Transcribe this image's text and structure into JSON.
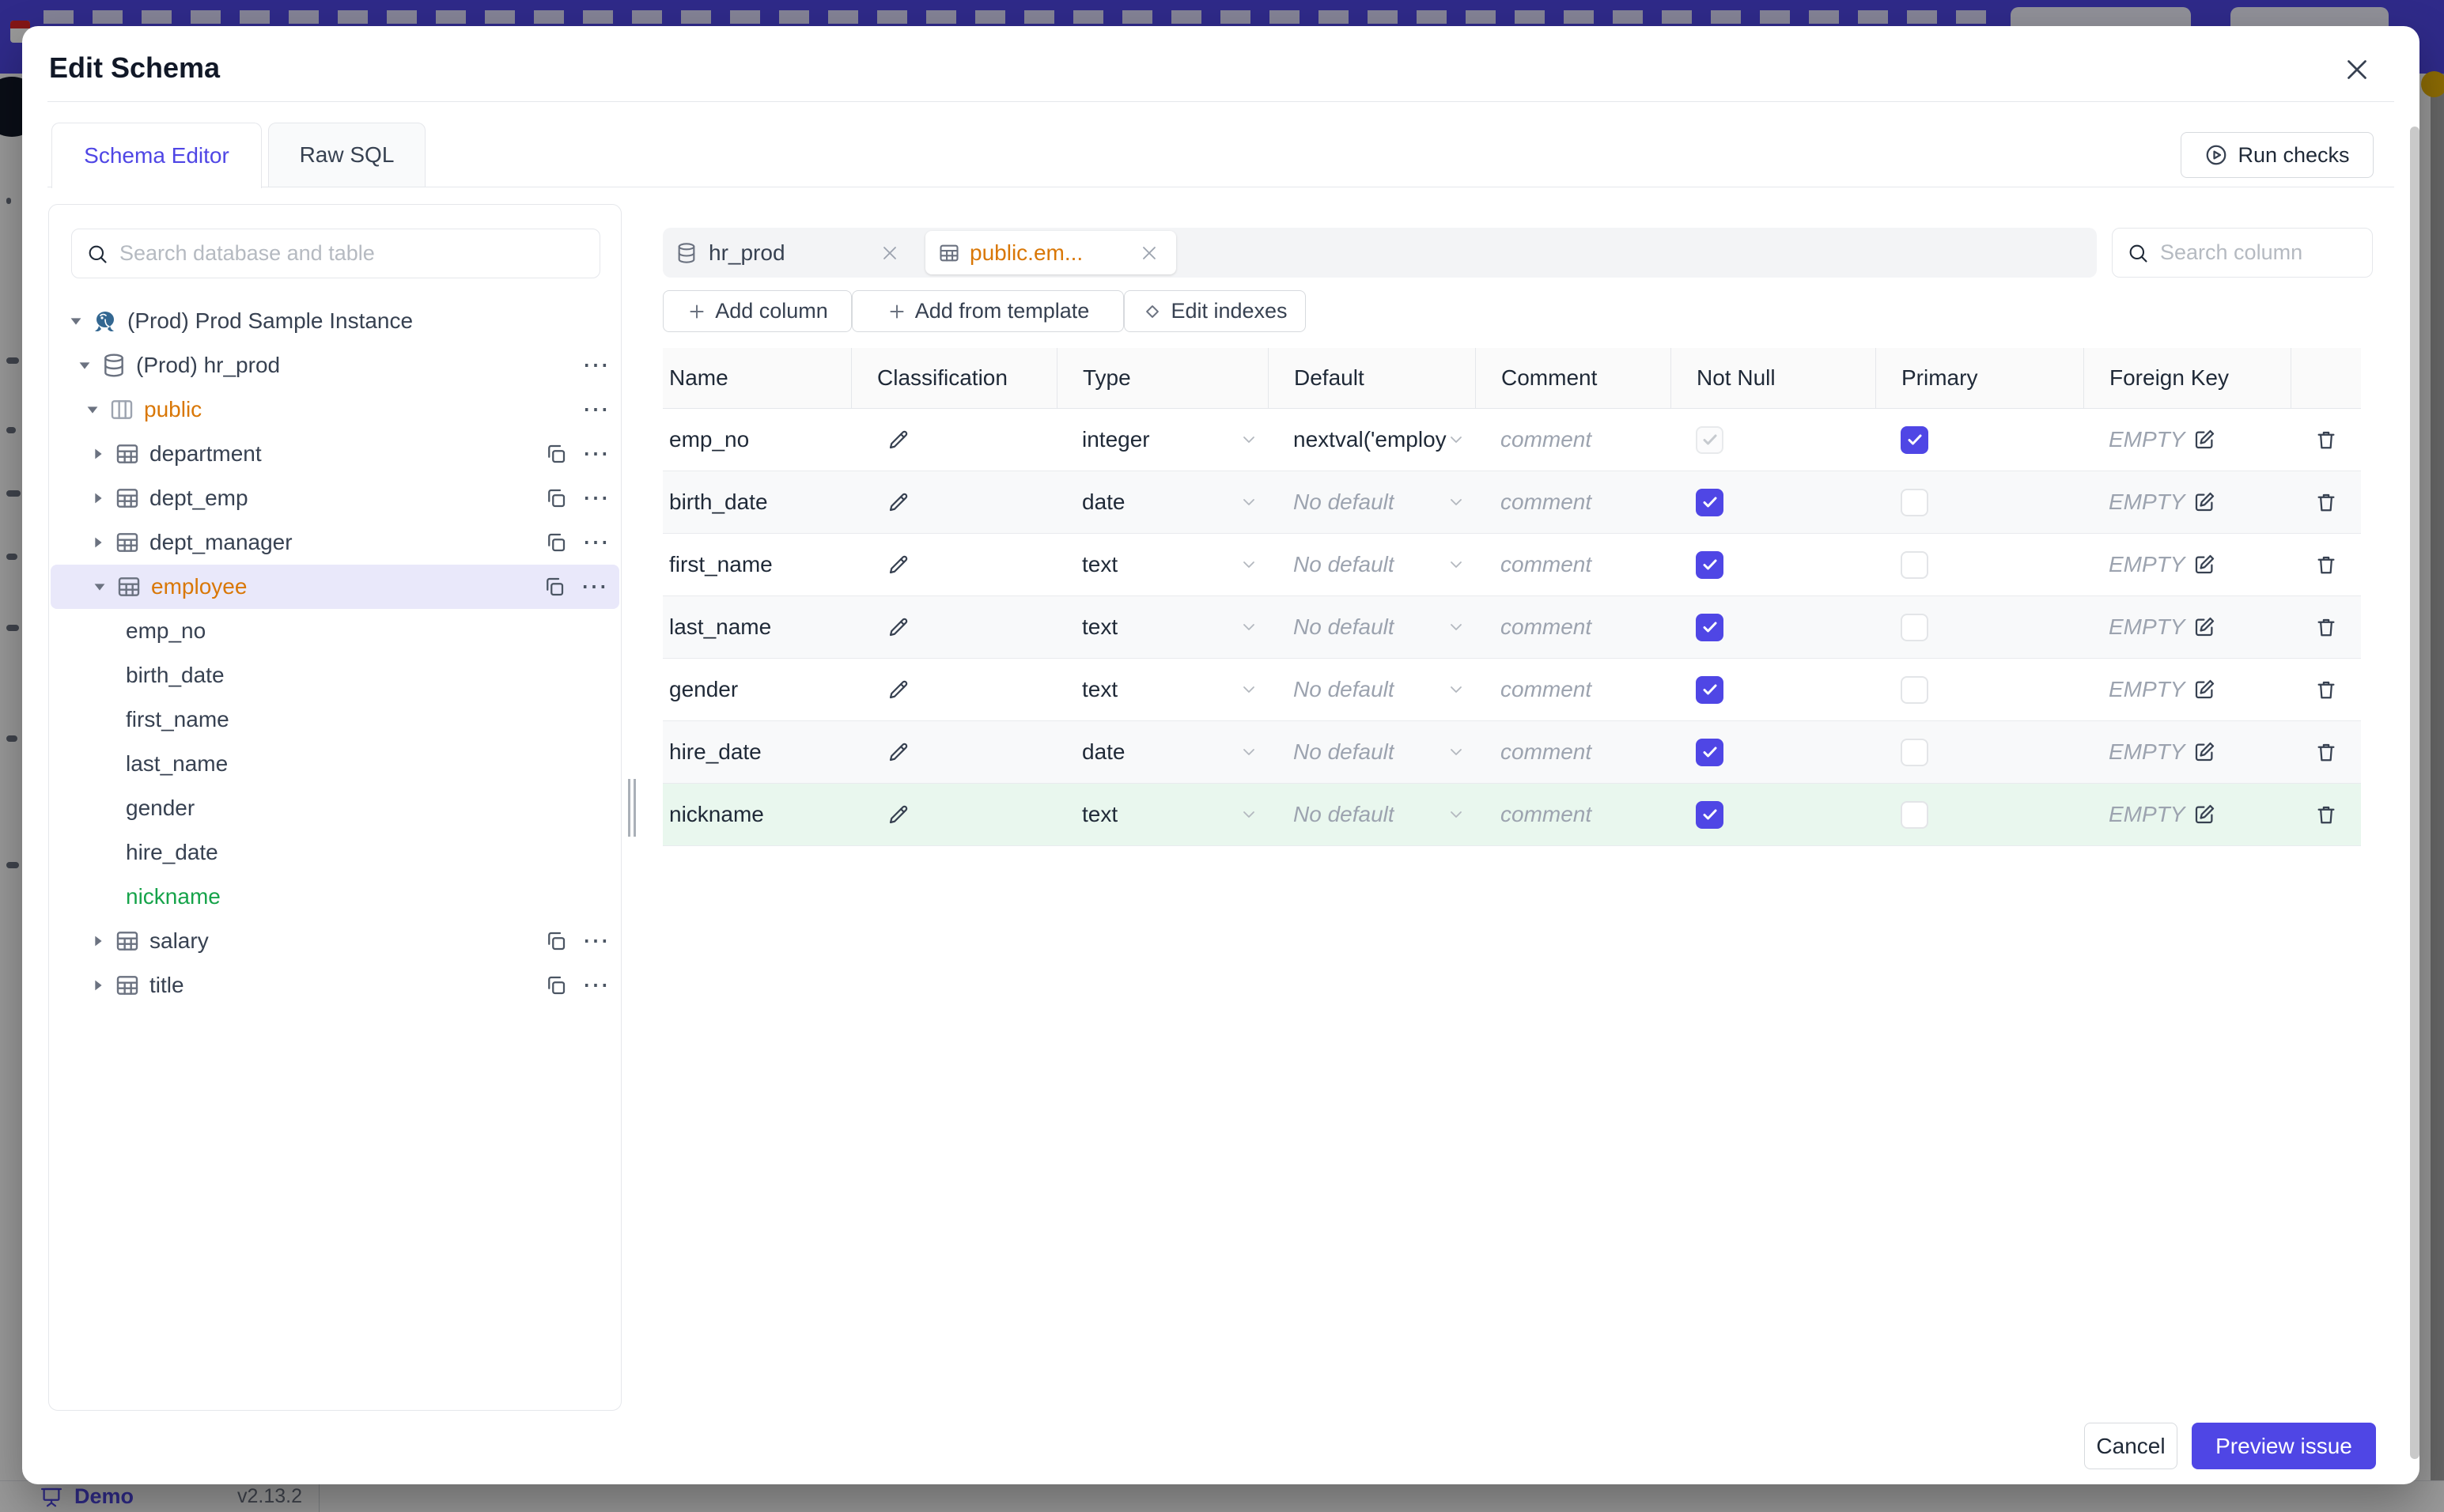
{
  "colors": {
    "accent": "#4f46e5",
    "amber": "#d97706",
    "green": "#16a34a",
    "selected_row_bg": "#e9e8fa",
    "highlight_row_bg": "#e9f7ee"
  },
  "backdrop": {
    "bottom_bar": {
      "demo_label": "Demo",
      "version": "v2.13.2"
    }
  },
  "modal": {
    "title": "Edit Schema",
    "tabs": [
      {
        "label": "Schema Editor",
        "active": true
      },
      {
        "label": "Raw SQL",
        "active": false
      }
    ],
    "run_checks_label": "Run checks",
    "sidebar": {
      "search_placeholder": "Search database and table",
      "tree": [
        {
          "label": "(Prod) Prod Sample Instance",
          "type": "instance"
        },
        {
          "label": "(Prod) hr_prod",
          "type": "database"
        },
        {
          "label": "public",
          "type": "schema"
        },
        {
          "label": "department",
          "type": "table"
        },
        {
          "label": "dept_emp",
          "type": "table"
        },
        {
          "label": "dept_manager",
          "type": "table"
        },
        {
          "label": "employee",
          "type": "table",
          "selected": true
        },
        {
          "label": "emp_no",
          "type": "column"
        },
        {
          "label": "birth_date",
          "type": "column"
        },
        {
          "label": "first_name",
          "type": "column"
        },
        {
          "label": "last_name",
          "type": "column"
        },
        {
          "label": "gender",
          "type": "column"
        },
        {
          "label": "hire_date",
          "type": "column"
        },
        {
          "label": "nickname",
          "type": "column",
          "status": "new"
        },
        {
          "label": "salary",
          "type": "table"
        },
        {
          "label": "title",
          "type": "table"
        }
      ]
    },
    "editor": {
      "tabs": [
        {
          "label": "hr_prod",
          "icon": "database"
        },
        {
          "label": "public.em...",
          "icon": "table",
          "active": true
        }
      ],
      "search_placeholder": "Search column",
      "toolbar": {
        "add_column": "Add column",
        "add_from_template": "Add from template",
        "edit_indexes": "Edit indexes"
      },
      "table": {
        "headers": [
          "Name",
          "Classification",
          "Type",
          "Default",
          "Comment",
          "Not Null",
          "Primary",
          "Foreign Key"
        ],
        "comment_placeholder": "comment",
        "foreign_key_empty": "EMPTY",
        "rows": [
          {
            "name": "emp_no",
            "type": "integer",
            "default": "nextval('employ",
            "not_null": "checked-disabled",
            "primary": true
          },
          {
            "name": "birth_date",
            "type": "date",
            "default": "No default",
            "not_null": "checked",
            "primary": false
          },
          {
            "name": "first_name",
            "type": "text",
            "default": "No default",
            "not_null": "checked",
            "primary": false
          },
          {
            "name": "last_name",
            "type": "text",
            "default": "No default",
            "not_null": "checked",
            "primary": false
          },
          {
            "name": "gender",
            "type": "text",
            "default": "No default",
            "not_null": "checked",
            "primary": false
          },
          {
            "name": "hire_date",
            "type": "date",
            "default": "No default",
            "not_null": "checked",
            "primary": false
          },
          {
            "name": "nickname",
            "type": "text",
            "default": "No default",
            "not_null": "checked",
            "primary": false,
            "highlight": true
          }
        ]
      }
    },
    "footer": {
      "cancel_label": "Cancel",
      "primary_label": "Preview issue"
    }
  }
}
